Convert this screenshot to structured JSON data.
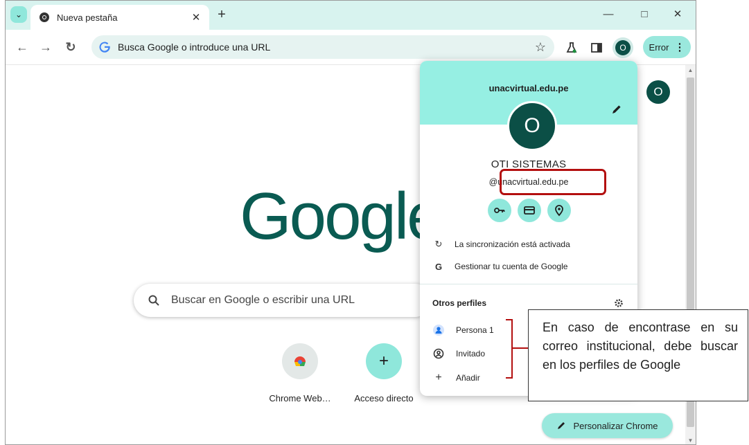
{
  "browser": {
    "tab_title": "Nueva pestaña",
    "omnibox_placeholder": "Busca Google o introduce una URL",
    "error_label": "Error",
    "avatar_letter": "O"
  },
  "page": {
    "logo_text": "Google",
    "search_placeholder": "Buscar en Google o escribir una URL",
    "shortcuts": [
      {
        "label": "Chrome Web…",
        "icon": "chrome-web-store-icon"
      },
      {
        "label": "Acceso directo",
        "icon": "add-icon"
      }
    ],
    "personalize_label": "Personalizar Chrome",
    "avatar_letter": "O"
  },
  "profile_panel": {
    "domain": "unacvirtual.edu.pe",
    "avatar_letter": "O",
    "name": "OTI SISTEMAS",
    "email": "@unacvirtual.edu.pe",
    "quick_buttons": [
      "password-key-icon",
      "payment-card-icon",
      "location-pin-icon"
    ],
    "sync_label": "La sincronización está activada",
    "manage_account_label": "Gestionar tu cuenta de Google",
    "other_profiles_title": "Otros perfiles",
    "other_profiles": [
      {
        "label": "Persona 1",
        "icon": "person-icon"
      },
      {
        "label": "Invitado",
        "icon": "guest-icon"
      },
      {
        "label": "Añadir",
        "icon": "add-icon"
      }
    ]
  },
  "annotation": {
    "callout_text": "En caso de encontrase en su correo institucional, debe buscar en los perfiles de Google"
  },
  "colors": {
    "accent": "#9ae8dd",
    "panel_header": "#96efe3",
    "avatar": "#0b4f46",
    "logo": "#0a5b52",
    "highlight": "#b30f0f"
  }
}
